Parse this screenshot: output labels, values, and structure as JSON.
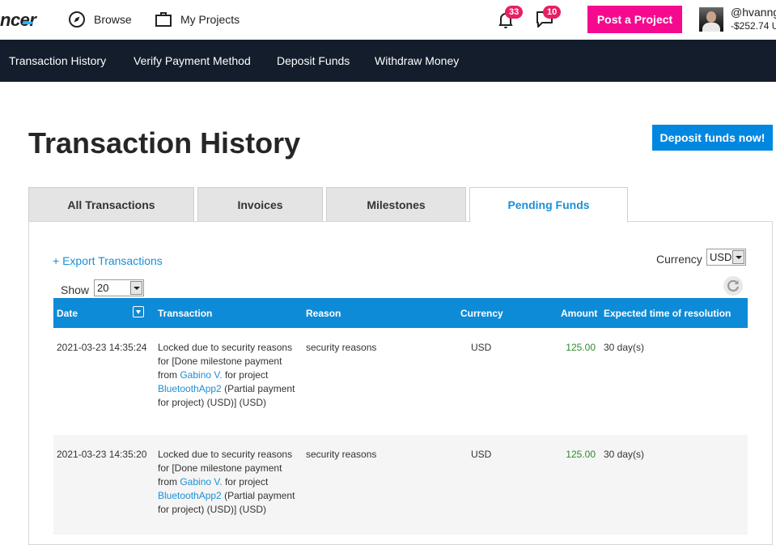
{
  "header": {
    "logo_text": "ncer",
    "browse_label": "Browse",
    "projects_label": "My Projects",
    "notifications_count": "33",
    "messages_count": "10",
    "post_project_label": "Post a Project",
    "username": "@hvanng",
    "balance": "-$252.74 U"
  },
  "subnav": {
    "items": [
      "Transaction History",
      "Verify Payment Method",
      "Deposit Funds",
      "Withdraw Money"
    ]
  },
  "page": {
    "title": "Transaction History",
    "deposit_button": "Deposit funds now!"
  },
  "tabs": [
    "All Transactions",
    "Invoices",
    "Milestones",
    "Pending Funds"
  ],
  "controls": {
    "export_label": "+ Export Transactions",
    "currency_label": "Currency",
    "currency_value": "USD",
    "show_label": "Show",
    "show_value": "20"
  },
  "table": {
    "headers": [
      "Date",
      "Transaction",
      "Reason",
      "Currency",
      "Amount",
      "Expected time of resolution"
    ],
    "rows": [
      {
        "date": "2021-03-23 14:35:24",
        "tx_prefix": "Locked due to security reasons for [Done milestone payment from ",
        "tx_user": "Gabino V.",
        "tx_mid": " for project ",
        "tx_project": "BluetoothApp2",
        "tx_suffix": " (Partial payment for project) (USD)] (USD)",
        "reason": "security reasons",
        "currency": "USD",
        "amount": "125.00",
        "expected": "30 day(s)"
      },
      {
        "date": "2021-03-23 14:35:20",
        "tx_prefix": "Locked due to security reasons for [Done milestone payment from ",
        "tx_user": "Gabino V.",
        "tx_mid": " for project ",
        "tx_project": "BluetoothApp2",
        "tx_suffix": " (Partial payment for project) (USD)] (USD)",
        "reason": "security reasons",
        "currency": "USD",
        "amount": "125.00",
        "expected": "30 day(s)"
      }
    ]
  },
  "colors": {
    "brand_pink": "#f50a8f",
    "primary_blue": "#0087e0",
    "navbar_dark": "#131d2b",
    "amount_green": "#2e8b2e"
  }
}
